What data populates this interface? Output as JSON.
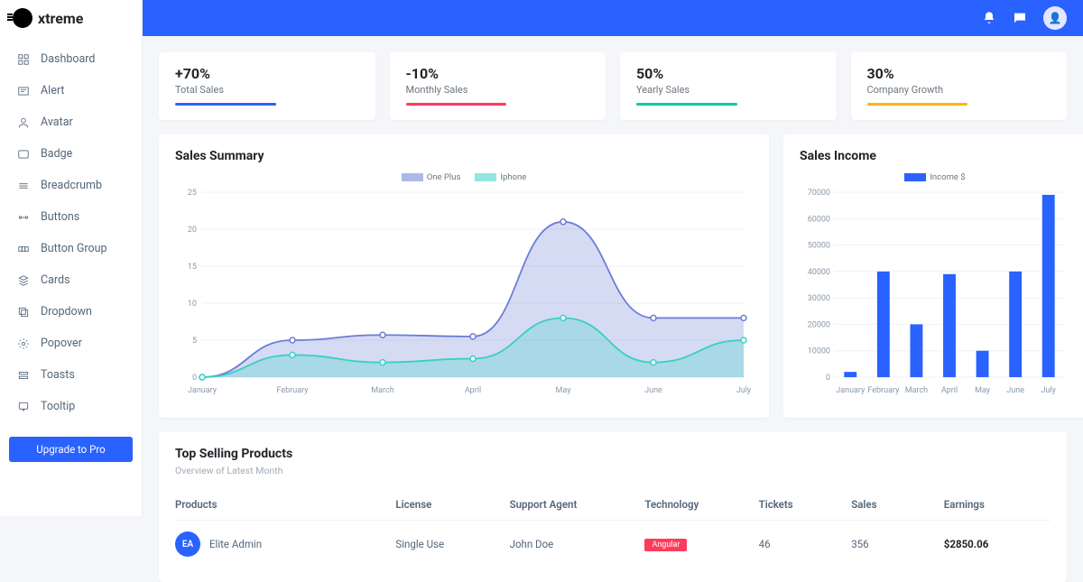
{
  "brand": {
    "name": "xtreme"
  },
  "sidebar": {
    "items": [
      {
        "label": "Dashboard",
        "icon": "dashboard"
      },
      {
        "label": "Alert",
        "icon": "alert"
      },
      {
        "label": "Avatar",
        "icon": "avatar"
      },
      {
        "label": "Badge",
        "icon": "badge"
      },
      {
        "label": "Breadcrumb",
        "icon": "breadcrumb"
      },
      {
        "label": "Buttons",
        "icon": "buttons"
      },
      {
        "label": "Button Group",
        "icon": "button-group"
      },
      {
        "label": "Cards",
        "icon": "cards"
      },
      {
        "label": "Dropdown",
        "icon": "dropdown"
      },
      {
        "label": "Popover",
        "icon": "popover"
      },
      {
        "label": "Toasts",
        "icon": "toasts"
      },
      {
        "label": "Tooltip",
        "icon": "tooltip"
      }
    ],
    "upgrade_label": "Upgrade to Pro"
  },
  "stats": [
    {
      "value": "+70%",
      "label": "Total Sales",
      "color": "#2962ff"
    },
    {
      "value": "-10%",
      "label": "Monthly Sales",
      "color": "#ff3b5c"
    },
    {
      "value": "50%",
      "label": "Yearly Sales",
      "color": "#00c9a7"
    },
    {
      "value": "30%",
      "label": "Company Growth",
      "color": "#ffb400"
    }
  ],
  "sales_summary": {
    "title": "Sales Summary"
  },
  "sales_income": {
    "title": "Sales Income"
  },
  "products_section": {
    "title": "Top Selling Products",
    "subtitle": "Overview of Latest Month",
    "headers": [
      "Products",
      "License",
      "Support Agent",
      "Technology",
      "Tickets",
      "Sales",
      "Earnings"
    ],
    "rows": [
      {
        "avatar": "EA",
        "name": "Elite Admin",
        "license": "Single Use",
        "agent": "John Doe",
        "tech": "Angular",
        "tickets": "46",
        "sales": "356",
        "earnings": "$2850.06"
      }
    ]
  },
  "chart_data": [
    {
      "type": "line",
      "title": "Sales Summary",
      "x": [
        "January",
        "February",
        "March",
        "April",
        "May",
        "June",
        "July"
      ],
      "ylim": [
        0,
        25
      ],
      "yticks": [
        0,
        5,
        10,
        15,
        20,
        25
      ],
      "series": [
        {
          "name": "One Plus",
          "color": "#6b7dd6",
          "values": [
            0,
            5,
            5.7,
            5.5,
            21,
            8,
            8
          ]
        },
        {
          "name": "Iphone",
          "color": "#36d1c4",
          "values": [
            0,
            3,
            2,
            2.5,
            8,
            2,
            5
          ]
        }
      ]
    },
    {
      "type": "bar",
      "title": "Sales Income",
      "categories": [
        "January",
        "February",
        "March",
        "April",
        "May",
        "June",
        "July"
      ],
      "ylim": [
        0,
        70000
      ],
      "yticks": [
        0,
        10000,
        20000,
        30000,
        40000,
        50000,
        60000,
        70000
      ],
      "series": [
        {
          "name": "Income $",
          "color": "#2962ff",
          "values": [
            2000,
            40000,
            20000,
            39000,
            10000,
            40000,
            69000
          ]
        }
      ]
    }
  ]
}
